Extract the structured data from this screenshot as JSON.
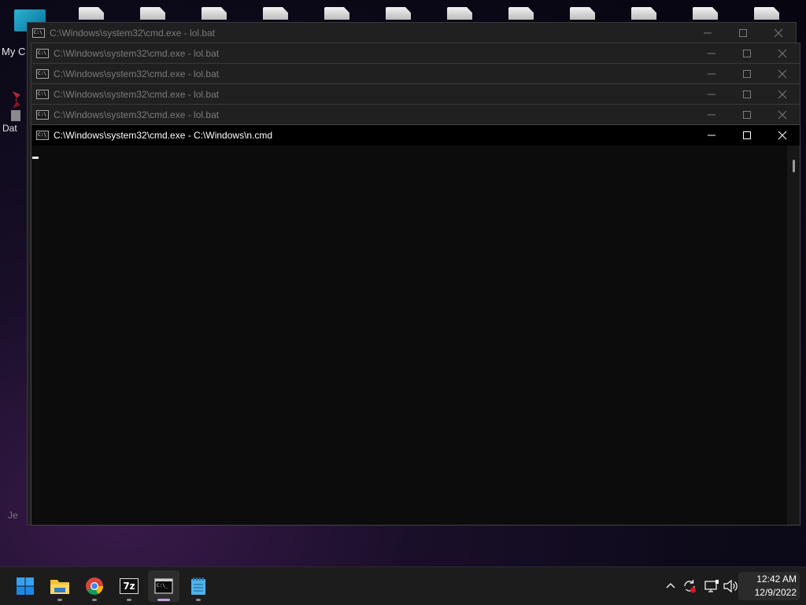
{
  "desktop": {
    "labels": [
      "My C",
      "Dat",
      "Je"
    ]
  },
  "windows": [
    {
      "title": "C:\\Windows\\system32\\cmd.exe - lol.bat"
    },
    {
      "title": "C:\\Windows\\system32\\cmd.exe - lol.bat"
    },
    {
      "title": "C:\\Windows\\system32\\cmd.exe - lol.bat"
    },
    {
      "title": "C:\\Windows\\system32\\cmd.exe - lol.bat"
    },
    {
      "title": "C:\\Windows\\system32\\cmd.exe - lol.bat"
    },
    {
      "title": "C:\\Windows\\system32\\cmd.exe - C:\\Windows\\n.cmd"
    }
  ],
  "taskbar": {
    "apps": [
      {
        "name": "start",
        "icon": "windows-logo-icon"
      },
      {
        "name": "file-explorer",
        "icon": "folder-icon"
      },
      {
        "name": "chrome",
        "icon": "chrome-icon"
      },
      {
        "name": "7-zip",
        "icon": "7zip-icon",
        "label": "7z"
      },
      {
        "name": "command-prompt",
        "icon": "terminal-icon"
      },
      {
        "name": "notepad",
        "icon": "notepad-icon"
      }
    ],
    "clock": {
      "time": "12:42 AM",
      "date": "12/9/2022"
    }
  },
  "colors": {
    "accent": "#0078d4",
    "active_indicator": "#c0a0e0"
  }
}
